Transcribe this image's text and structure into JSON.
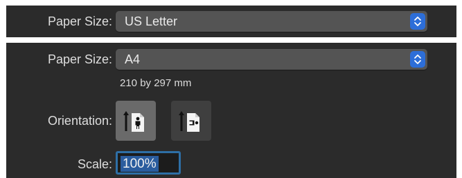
{
  "top_panel": {
    "paper_size_label": "Paper Size:",
    "paper_size_value": "US Letter"
  },
  "main_panel": {
    "paper_size_label": "Paper Size:",
    "paper_size_value": "A4",
    "paper_dimensions": "210 by 297 mm",
    "orientation_label": "Orientation:",
    "orientation_options": [
      {
        "name": "portrait",
        "icon": "portrait-orientation-icon",
        "selected": true
      },
      {
        "name": "landscape",
        "icon": "landscape-orientation-icon",
        "selected": false
      }
    ],
    "scale_label": "Scale:",
    "scale_value": "100%"
  },
  "colors": {
    "panel_background": "#2b2b2b",
    "popup_background": "#545454",
    "accent_blue": "#2d6ed8",
    "focus_ring": "#2e6fa6"
  }
}
